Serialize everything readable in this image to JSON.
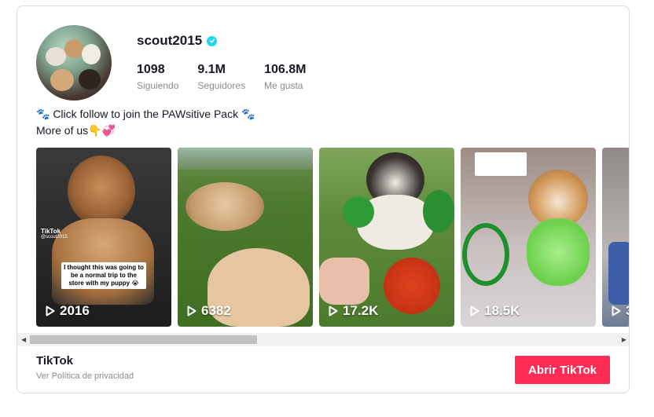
{
  "profile": {
    "username": "scout2015",
    "verified_icon": "verified-badge-icon",
    "stats": [
      {
        "value": "1098",
        "label": "Siguiendo"
      },
      {
        "value": "9.1M",
        "label": "Seguidores"
      },
      {
        "value": "106.8M",
        "label": "Me gusta"
      }
    ],
    "bio_line1": "🐾 Click follow to join the PAWsitive Pack 🐾",
    "bio_line2": "More of us👇💞"
  },
  "videos": [
    {
      "views": "2016",
      "overlay_brand": "TikTok",
      "overlay_handle": "@scout2015",
      "caption": "I thought this was going to be a normal trip to the store with my puppy 😭"
    },
    {
      "views": "6382"
    },
    {
      "views": "17.2K"
    },
    {
      "views": "18.5K"
    },
    {
      "views": "3"
    }
  ],
  "footer": {
    "brand": "TikTok",
    "privacy": "Ver Política de privacidad",
    "open_button": "Abrir TikTok"
  },
  "colors": {
    "accent": "#fe2c55",
    "verified": "#20d5ec",
    "muted_text": "#8a8b91"
  }
}
